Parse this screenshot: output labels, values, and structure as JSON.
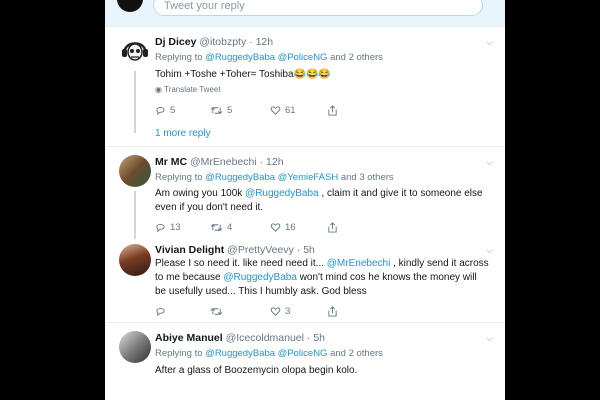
{
  "reply_box": {
    "placeholder": "Tweet your reply"
  },
  "tweets": [
    {
      "name": "Dj Dicey",
      "handle": "@itobzpty",
      "time": "12h",
      "replying_label": "Replying to",
      "mentions": [
        "@RuggedyBaba",
        "@PoliceNG"
      ],
      "others": "and 2 others",
      "text": "Tohim +Toshe +Toher= Toshiba😂😂😂",
      "translate": "Translate Tweet",
      "replies": "5",
      "retweets": "5",
      "likes": "61",
      "more_replies": "1 more reply"
    },
    {
      "name": "Mr MC",
      "handle": "@MrEnebechi",
      "time": "12h",
      "replying_label": "Replying to",
      "mentions": [
        "@RuggedyBaba",
        "@YemieFASH"
      ],
      "others": "and 3 others",
      "text_parts": [
        "Am owing you 100k ",
        "@RuggedyBaba",
        " , claim it and give it to someone else even if you don't need it."
      ],
      "replies": "13",
      "retweets": "4",
      "likes": "16"
    },
    {
      "name": "Vivian Delight",
      "handle": "@PrettyVeevy",
      "time": "5h",
      "text_parts": [
        "Please I so need it. like need need it...  ",
        "@MrEnebechi",
        " , kindly send it across to me because ",
        "@RuggedyBaba",
        " won't mind cos he knows the money will be usefully used... This I humbly ask. God bless"
      ],
      "replies": "",
      "retweets": "",
      "likes": "3"
    },
    {
      "name": "Abiye Manuel",
      "handle": "@Icecoldmanuel",
      "time": "5h",
      "replying_label": "Replying to",
      "mentions": [
        "@RuggedyBaba",
        "@PoliceNG"
      ],
      "others": "and 2 others",
      "text": "After a glass of Boozemycin olopa begin kolo."
    }
  ],
  "colors": {
    "link": "#1b95e0",
    "muted": "#657786",
    "text": "#14171a"
  }
}
